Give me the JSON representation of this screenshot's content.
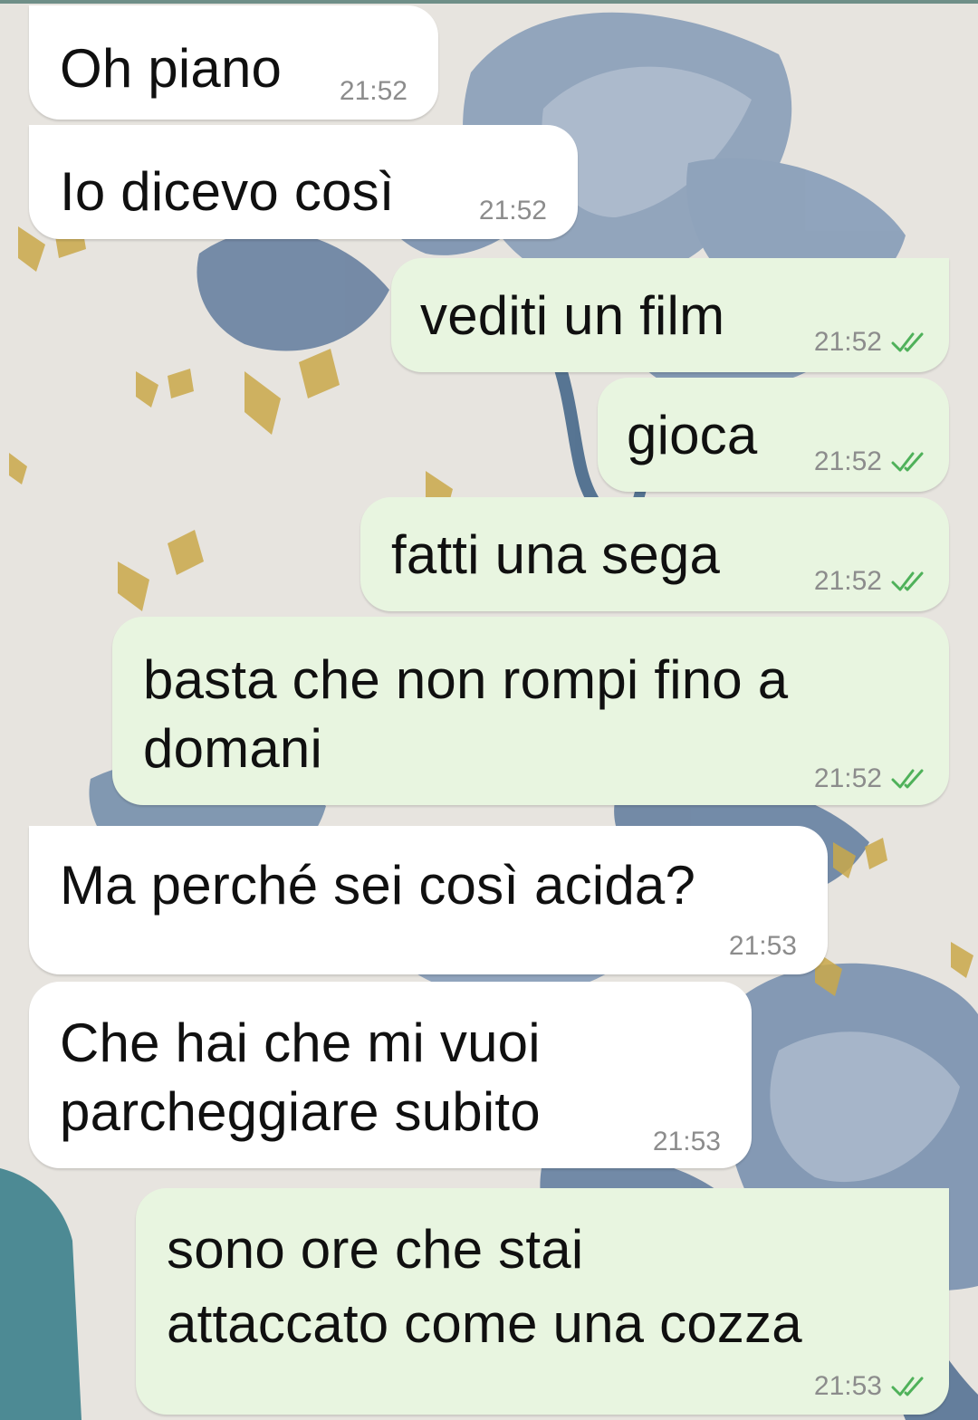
{
  "messages": [
    {
      "dir": "in",
      "text": "Oh piano",
      "time": "21:52",
      "read": false
    },
    {
      "dir": "in",
      "text": "Io dicevo così",
      "time": "21:52",
      "read": false
    },
    {
      "dir": "out",
      "text": "vediti un film",
      "time": "21:52",
      "read": true
    },
    {
      "dir": "out",
      "text": "gioca",
      "time": "21:52",
      "read": true
    },
    {
      "dir": "out",
      "text": "fatti una sega",
      "time": "21:52",
      "read": true
    },
    {
      "dir": "out",
      "text_lines": [
        "basta che non rompi fino a",
        "domani"
      ],
      "time": "21:52",
      "read": true
    },
    {
      "dir": "in",
      "text": "Ma perché sei così acida?",
      "time": "21:53",
      "read": false
    },
    {
      "dir": "in",
      "text_lines": [
        "Che hai che mi vuoi",
        "parcheggiare subito"
      ],
      "time": "21:53",
      "read": false
    },
    {
      "dir": "out",
      "text_lines": [
        "sono ore che stai",
        "attaccato come una cozza"
      ],
      "time": "21:53",
      "read": true
    }
  ],
  "icons": {
    "read_receipt": "double-check-icon",
    "read_receipt_color": "#4fb15a"
  },
  "colors": {
    "incoming_bubble": "#ffffff",
    "outgoing_bubble": "#e8f5e0",
    "timestamp": "#8c8c8c"
  }
}
